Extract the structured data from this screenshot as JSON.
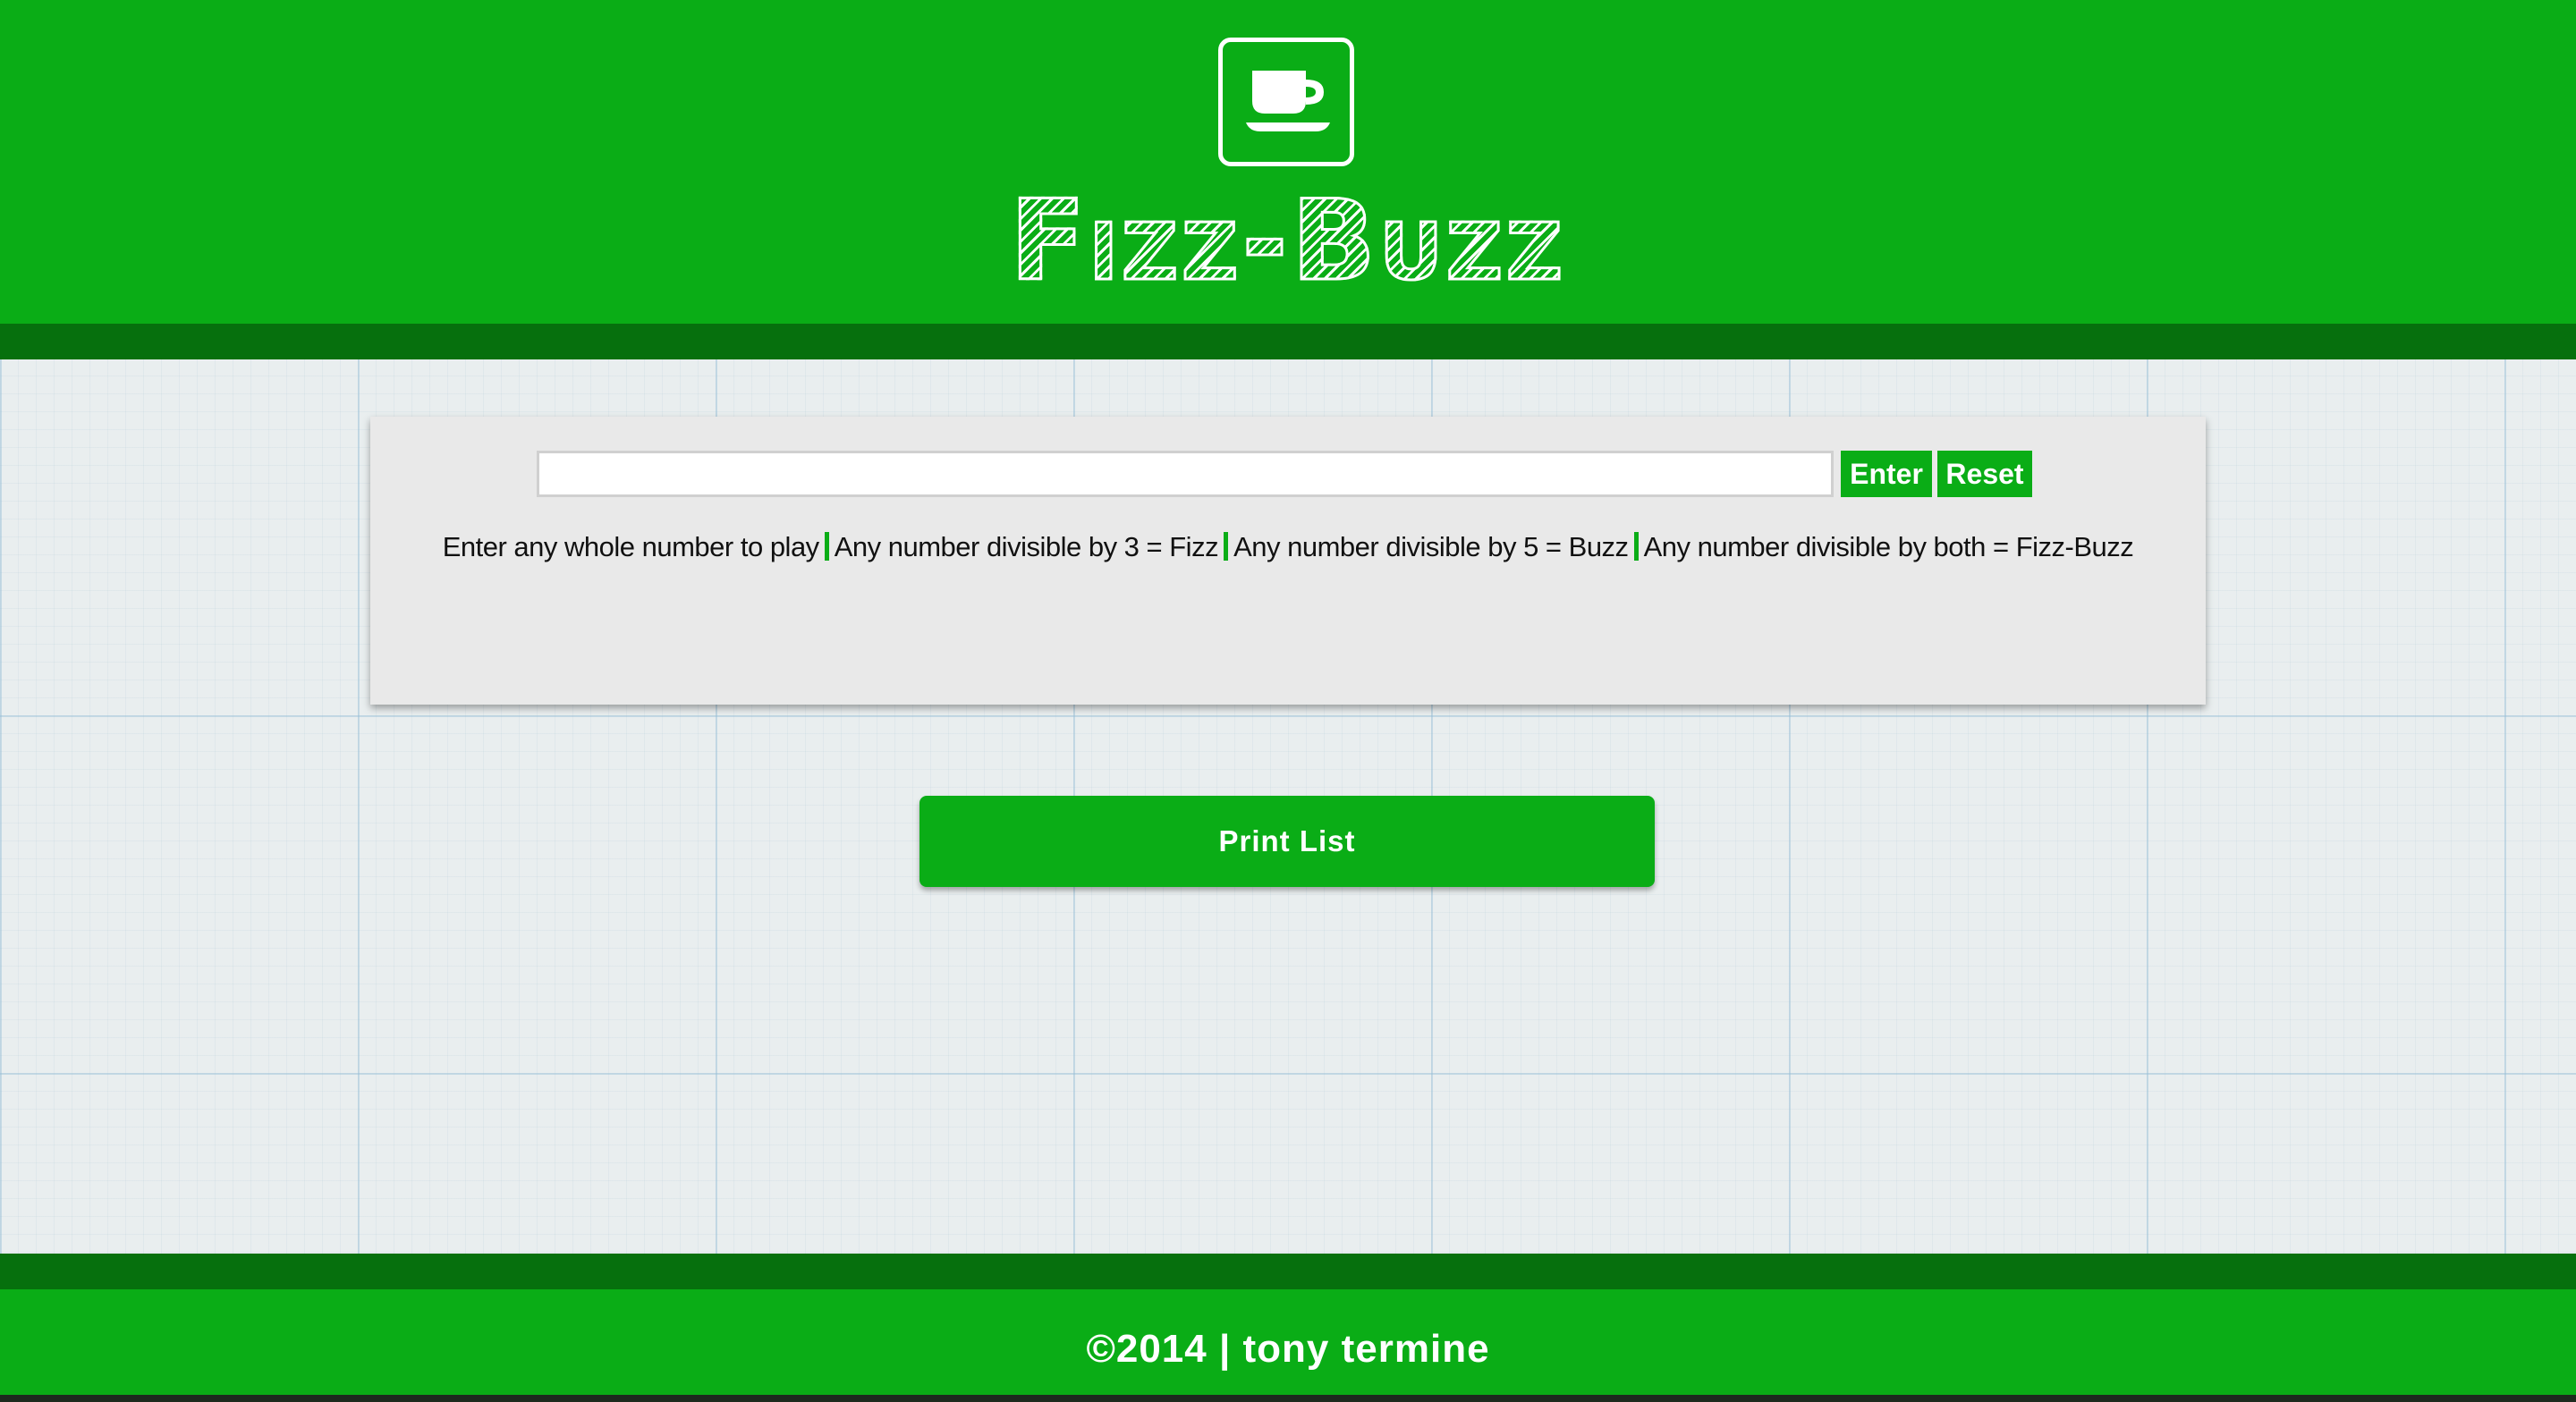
{
  "header": {
    "logo_icon": "coffee-cup-icon",
    "title": "Fizz-Buzz"
  },
  "game": {
    "input_value": "",
    "input_placeholder": "",
    "enter_label": "Enter",
    "reset_label": "Reset",
    "rules": [
      "Enter any whole number to play",
      "Any number divisible by 3 = Fizz",
      "Any number divisible by 5 = Buzz",
      "Any number divisible by both = Fizz-Buzz"
    ]
  },
  "print_button_label": "Print List",
  "footer": {
    "text": "©2014 | tony termine"
  },
  "colors": {
    "brand_green": "#0aad16",
    "dark_green": "#06700d",
    "panel": "#e9e9e9",
    "background": "#e9eeef"
  }
}
